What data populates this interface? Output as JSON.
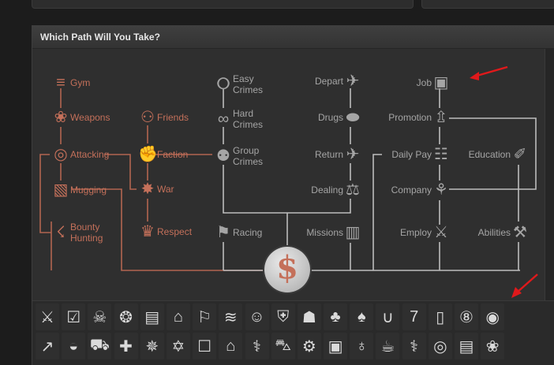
{
  "header": {
    "title": "Which Path Will You Take?"
  },
  "center_icon": {
    "symbol": "$"
  },
  "left_nodes": [
    {
      "label": "Gym",
      "icon": "≡",
      "icon_name": "dumbbell-icon"
    },
    {
      "label": "Weapons",
      "icon": "❀",
      "icon_name": "brass-knuckles-icon"
    },
    {
      "label": "Attacking",
      "icon": "◎",
      "icon_name": "crosshair-icon"
    },
    {
      "label": "Mugging",
      "icon": "▧",
      "icon_name": "wallet-icon"
    },
    {
      "label": "Bounty\nHunting",
      "icon": "☇",
      "icon_name": "gunman-icon"
    },
    {
      "label": "Friends",
      "icon": "⚇",
      "icon_name": "people-icon"
    },
    {
      "label": "Faction",
      "icon": "✊",
      "icon_name": "fist-icon"
    },
    {
      "label": "War",
      "icon": "✸",
      "icon_name": "explosion-icon"
    },
    {
      "label": "Respect",
      "icon": "♛",
      "icon_name": "crown-icon"
    }
  ],
  "center_nodes": [
    {
      "label": "Easy\nCrimes",
      "icon": "ⵔ",
      "icon_name": "money-bag-icon"
    },
    {
      "label": "Hard\nCrimes",
      "icon": "∞",
      "icon_name": "handcuffs-icon"
    },
    {
      "label": "Group\nCrimes",
      "icon": "⚉",
      "icon_name": "group-icon"
    },
    {
      "label": "Racing",
      "icon": "⚑",
      "icon_name": "checkered-flag-icon"
    },
    {
      "label": "Depart",
      "icon": "✈",
      "icon_name": "plane-depart-icon"
    },
    {
      "label": "Drugs",
      "icon": "⬬",
      "icon_name": "pill-icon"
    },
    {
      "label": "Return",
      "icon": "✈",
      "icon_name": "plane-return-icon"
    },
    {
      "label": "Dealing",
      "icon": "⚖",
      "icon_name": "scales-icon"
    },
    {
      "label": "Missions",
      "icon": "▥",
      "icon_name": "map-icon"
    }
  ],
  "right_nodes": [
    {
      "label": "Job",
      "icon": "▣",
      "icon_name": "briefcase-icon"
    },
    {
      "label": "Promotion",
      "icon": "⇫",
      "icon_name": "arrow-up-icon"
    },
    {
      "label": "Daily Pay",
      "icon": "☷",
      "icon_name": "coins-icon"
    },
    {
      "label": "Company",
      "icon": "⚘",
      "icon_name": "company-icon"
    },
    {
      "label": "Employ",
      "icon": "⚔",
      "icon_name": "handshake-icon"
    },
    {
      "label": "Education",
      "icon": "✐",
      "icon_name": "diploma-icon"
    },
    {
      "label": "Abilities",
      "icon": "⚒",
      "icon_name": "hat-wand-icon"
    }
  ],
  "icon_rows": [
    [
      {
        "name": "knife-icon",
        "glyph": "⚔"
      },
      {
        "name": "revolver-icon",
        "glyph": "☑"
      },
      {
        "name": "rifle-icon",
        "glyph": "☠"
      },
      {
        "name": "grenade-icon",
        "glyph": "❂"
      },
      {
        "name": "id-card-icon",
        "glyph": "▤"
      },
      {
        "name": "house-icon",
        "glyph": "⌂"
      },
      {
        "name": "signpost-icon",
        "glyph": "⚐"
      },
      {
        "name": "swimmer-icon",
        "glyph": "≋"
      },
      {
        "name": "person-icon",
        "glyph": "☺"
      },
      {
        "name": "shield-icon",
        "glyph": "⛨"
      },
      {
        "name": "factory-icon",
        "glyph": "☗"
      },
      {
        "name": "cards-icon",
        "glyph": "♣"
      },
      {
        "name": "spade-icon",
        "glyph": "♠"
      },
      {
        "name": "horseshoe-icon",
        "glyph": "∪"
      },
      {
        "name": "slot-seven-icon",
        "glyph": "7"
      },
      {
        "name": "lottery-ticket-icon",
        "glyph": "▯"
      },
      {
        "name": "eight-ball-icon",
        "glyph": "⑧"
      },
      {
        "name": "poker-chip-icon",
        "glyph": "◉"
      }
    ],
    [
      {
        "name": "stocks-chart-icon",
        "glyph": "↗"
      },
      {
        "name": "piggy-bank-icon",
        "glyph": "◒"
      },
      {
        "name": "shopping-cart-icon",
        "glyph": "⛟"
      },
      {
        "name": "medical-kit-icon",
        "glyph": "✚"
      },
      {
        "name": "virus-icon",
        "glyph": "✵"
      },
      {
        "name": "syringe-icon",
        "glyph": "✡"
      },
      {
        "name": "unlocked-padlock-icon",
        "glyph": "☐"
      },
      {
        "name": "graduation-cap-icon",
        "glyph": "⌂"
      },
      {
        "name": "doctor-icon",
        "glyph": "⚕"
      },
      {
        "name": "car-icon",
        "glyph": "⛍"
      },
      {
        "name": "gear-icon",
        "glyph": "⚙"
      },
      {
        "name": "briefcase-icon",
        "glyph": "▣"
      },
      {
        "name": "bottle-icon",
        "glyph": "♁"
      },
      {
        "name": "pint-glass-icon",
        "glyph": "☕"
      },
      {
        "name": "candy-cane-icon",
        "glyph": "⚕"
      },
      {
        "name": "coins-icon",
        "glyph": "◎"
      },
      {
        "name": "newspaper-icon",
        "glyph": "▤"
      },
      {
        "name": "palette-icon",
        "glyph": "❀"
      }
    ]
  ],
  "colors": {
    "orange": "#c4705a",
    "gray": "#a5a5a5",
    "line_orange": "#b26550",
    "line_gray": "#bdbdbd",
    "arrow": "#e0191b"
  }
}
